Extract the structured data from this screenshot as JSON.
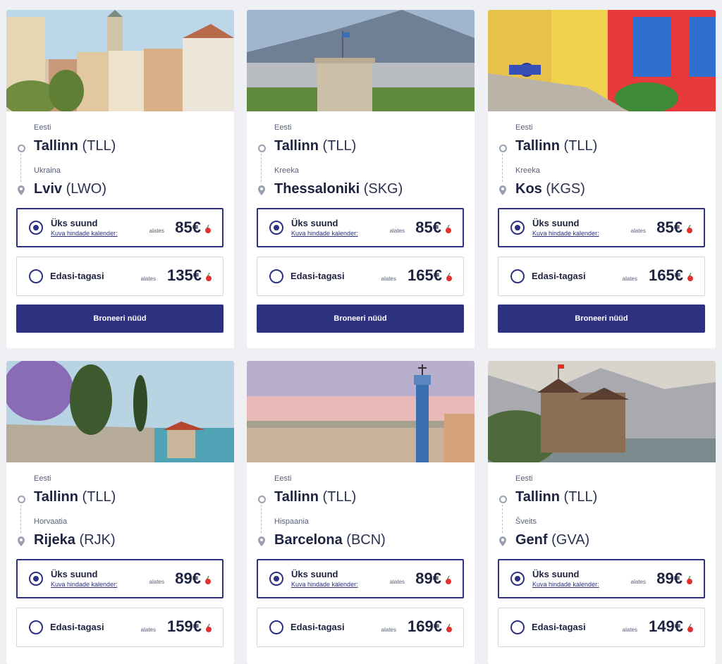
{
  "cards": [
    {
      "from_country": "Eesti",
      "from_city": "Tallinn",
      "from_code": "(TLL)",
      "to_country": "Ukraina",
      "to_city": "Lviv",
      "to_code": "(LWO)",
      "one_way_label": "Üks suund",
      "calendar_link": "Kuva hindade kalender:",
      "from_prefix": "alates",
      "one_way_price": "85€",
      "return_label": "Edasi-tagasi",
      "return_price": "135€",
      "book_label": "Broneeri nüüd"
    },
    {
      "from_country": "Eesti",
      "from_city": "Tallinn",
      "from_code": "(TLL)",
      "to_country": "Kreeka",
      "to_city": "Thessaloniki",
      "to_code": "(SKG)",
      "one_way_label": "Üks suund",
      "calendar_link": "Kuva hindade kalender:",
      "from_prefix": "alates",
      "one_way_price": "85€",
      "return_label": "Edasi-tagasi",
      "return_price": "165€",
      "book_label": "Broneeri nüüd"
    },
    {
      "from_country": "Eesti",
      "from_city": "Tallinn",
      "from_code": "(TLL)",
      "to_country": "Kreeka",
      "to_city": "Kos",
      "to_code": "(KGS)",
      "one_way_label": "Üks suund",
      "calendar_link": "Kuva hindade kalender:",
      "from_prefix": "alates",
      "one_way_price": "85€",
      "return_label": "Edasi-tagasi",
      "return_price": "165€",
      "book_label": "Broneeri nüüd"
    },
    {
      "from_country": "Eesti",
      "from_city": "Tallinn",
      "from_code": "(TLL)",
      "to_country": "Horvaatia",
      "to_city": "Rijeka",
      "to_code": "(RJK)",
      "one_way_label": "Üks suund",
      "calendar_link": "Kuva hindade kalender:",
      "from_prefix": "alates",
      "one_way_price": "89€",
      "return_label": "Edasi-tagasi",
      "return_price": "159€"
    },
    {
      "from_country": "Eesti",
      "from_city": "Tallinn",
      "from_code": "(TLL)",
      "to_country": "Hispaania",
      "to_city": "Barcelona",
      "to_code": "(BCN)",
      "one_way_label": "Üks suund",
      "calendar_link": "Kuva hindade kalender:",
      "from_prefix": "alates",
      "one_way_price": "89€",
      "return_label": "Edasi-tagasi",
      "return_price": "169€"
    },
    {
      "from_country": "Eesti",
      "from_city": "Tallinn",
      "from_code": "(TLL)",
      "to_country": "Šveits",
      "to_city": "Genf",
      "to_code": "(GVA)",
      "one_way_label": "Üks suund",
      "calendar_link": "Kuva hindade kalender:",
      "from_prefix": "alates",
      "one_way_price": "89€",
      "return_label": "Edasi-tagasi",
      "return_price": "149€"
    }
  ],
  "icons": {
    "origin": "origin-circle-icon",
    "destination": "location-pin-icon",
    "badge": "cherry-icon"
  },
  "colors": {
    "primary": "#2c3180",
    "background": "#eef0f4",
    "text": "#1d2240",
    "badge": "#e2312f"
  }
}
